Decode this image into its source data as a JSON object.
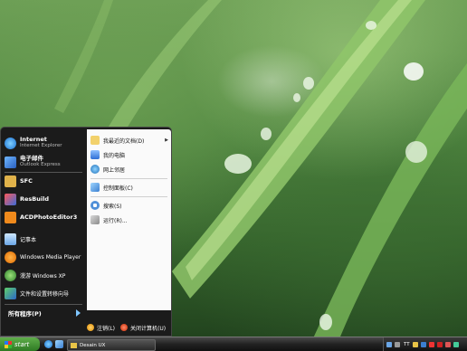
{
  "start_menu": {
    "pinned": [
      {
        "title": "Internet",
        "subtitle": "Internet Explorer"
      },
      {
        "title": "电子邮件",
        "subtitle": "Outlook Express"
      }
    ],
    "recent": [
      {
        "label": "SFC"
      },
      {
        "label": "ResBuild"
      },
      {
        "label": "ACDPhotoEditor3"
      },
      {
        "label": "记事本"
      },
      {
        "label": "Windows Media Player"
      },
      {
        "label": "漫游 Windows XP"
      },
      {
        "label": "文件和设置转移向导"
      }
    ],
    "all_programs_label": "所有程序(P)",
    "right_items": [
      {
        "label": "我最近的文档(D)",
        "has_submenu": true
      },
      {
        "label": "我的电脑"
      },
      {
        "label": "网上邻居"
      },
      {
        "label": "控制面板(C)"
      },
      {
        "label": "搜索(S)"
      },
      {
        "label": "运行(R)..."
      }
    ],
    "logoff_label": "注销(L)",
    "shutdown_label": "关闭计算机(U)"
  },
  "taskbar": {
    "start_label": "start",
    "task_label": "Desain UX",
    "tray_lang": "TT"
  },
  "colors": {
    "menu_bg": "#1b1b1b",
    "accent_blue": "#7fc6ff",
    "start_green": "#3c8f2e"
  }
}
